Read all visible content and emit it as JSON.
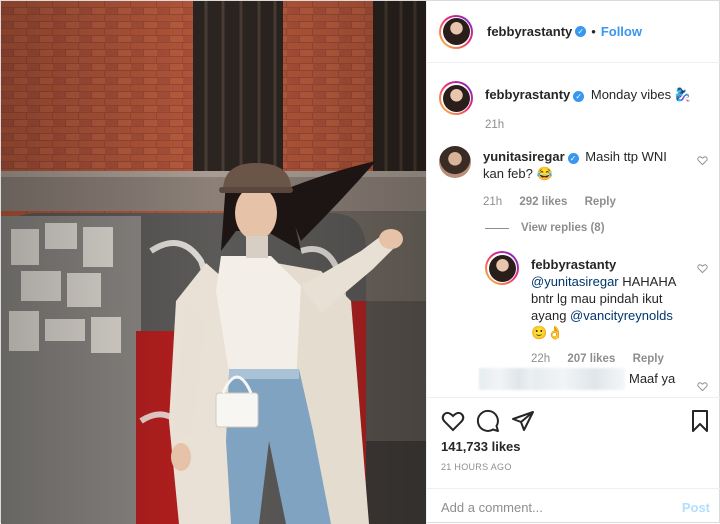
{
  "header": {
    "username": "febbyrastanty",
    "separator": "•",
    "follow_label": "Follow"
  },
  "caption": {
    "username": "febbyrastanty",
    "text": "Monday vibes",
    "emoji": "🧞‍♀️",
    "time": "21h"
  },
  "comment1": {
    "username": "yunitasiregar",
    "text_line1": "Masih ttp WNI",
    "text_line2": "kan feb? 😂",
    "time": "21h",
    "likes": "292 likes",
    "reply_label": "Reply"
  },
  "view_replies_label": "View replies (8)",
  "reply1": {
    "username": "febbyrastanty",
    "mention1": "@yunitasiregar",
    "text_a": " HAHAHA",
    "text_b": "bntr lg mau pindah ikut",
    "text_c": "ayang ",
    "mention2": "@vancityreynolds",
    "emojis": "🙂👌",
    "time": "22h",
    "likes": "207 likes",
    "reply_label": "Reply"
  },
  "comment_partial": {
    "text": "Maaf ya"
  },
  "icons": {
    "verified": "verified-badge-icon",
    "heart": "heart-icon",
    "comment": "comment-icon",
    "share": "share-icon",
    "save": "bookmark-icon"
  },
  "actions": {
    "likes": "141,733 likes",
    "timeago": "21 HOURS AGO"
  },
  "add_comment": {
    "placeholder": "Add a comment...",
    "post_label": "Post"
  },
  "colors": {
    "link_blue": "#3897f0",
    "mention": "#00376b",
    "muted": "#8e8e8e",
    "post_disabled": "#b2dffc"
  }
}
